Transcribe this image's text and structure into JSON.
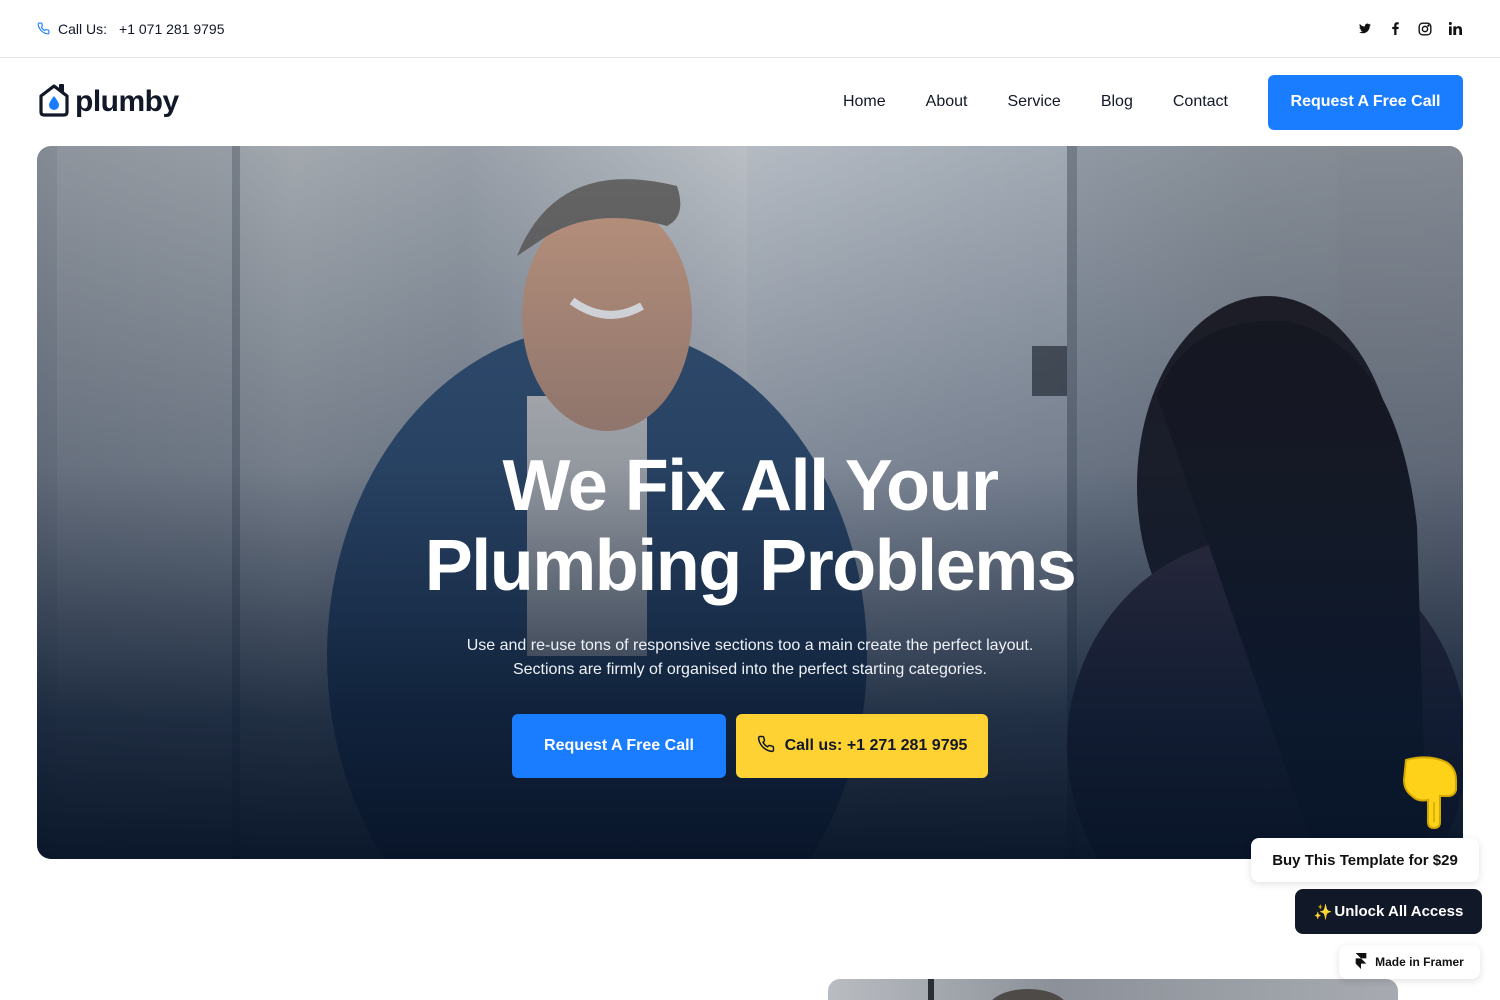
{
  "topbar": {
    "call_label": "Call Us:",
    "phone": "+1 071 281 9795",
    "socials": [
      "twitter-icon",
      "facebook-icon",
      "instagram-icon",
      "linkedin-icon"
    ]
  },
  "header": {
    "logo_text": "plumby",
    "nav": [
      "Home",
      "About",
      "Service",
      "Blog",
      "Contact"
    ],
    "cta_label": "Request A Free Call"
  },
  "hero": {
    "title_line1": "We Fix All Your",
    "title_line2": "Plumbing Problems",
    "subtitle_line1": "Use and re-use tons of responsive sections too a main create the perfect layout.",
    "subtitle_line2": "Sections are firmly of organised into the perfect starting categories.",
    "primary_button": "Request A Free Call",
    "call_button": "Call us: +1 271 281 9795"
  },
  "overlay": {
    "buy_label": "Buy This Template for $29",
    "unlock_label": "Unlock All Access",
    "unlock_emoji": "✨",
    "framer_label": "Made in Framer"
  },
  "colors": {
    "accent_blue": "#1a7cff",
    "accent_yellow": "#ffd234",
    "dark": "#111827"
  }
}
